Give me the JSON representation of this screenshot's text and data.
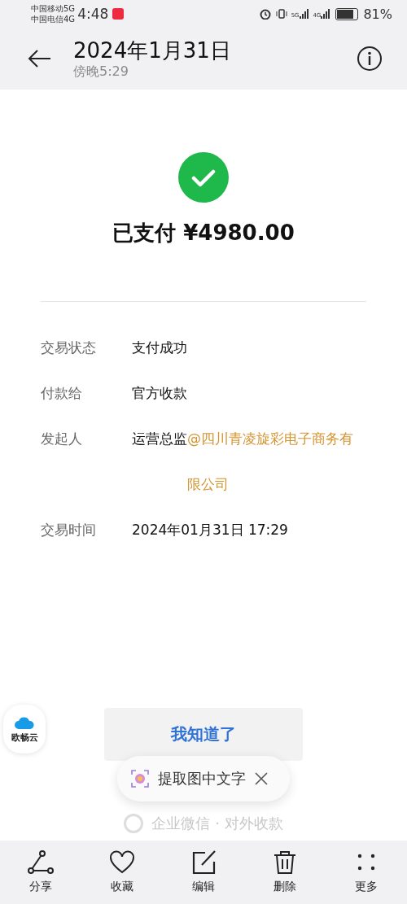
{
  "status_bar": {
    "carrier_1": "中国移动5G",
    "carrier_2": "中国电信4G",
    "time": "4:48",
    "signal_1": "5G",
    "signal_2": "4G",
    "battery": "81%",
    "battery_meter": {
      "level": 0.81
    }
  },
  "header": {
    "title": "2024年1月31日",
    "subtitle": "傍晚5:29"
  },
  "payment": {
    "status": "已支付 ¥4980.00",
    "success": true
  },
  "details": [
    {
      "label": "交易状态",
      "value": "支付成功"
    },
    {
      "label": "付款给",
      "value": "官方收款"
    },
    {
      "label": "发起人",
      "value": "运营总监",
      "link": "@四川青凌旋彩电子商务有限公司"
    },
    {
      "label": "交易时间",
      "value": "2024年01月31日 17:29"
    }
  ],
  "floating_badge": {
    "label": "欧畅云"
  },
  "confirm_button": "我知道了",
  "toast": {
    "label": "提取图中文字"
  },
  "footer_text": "企业微信 · 对外收款",
  "toolbar": [
    {
      "kind": "share",
      "label": "分享"
    },
    {
      "kind": "favorite",
      "label": "收藏"
    },
    {
      "kind": "edit",
      "label": "编辑"
    },
    {
      "kind": "delete",
      "label": "删除"
    },
    {
      "kind": "more",
      "label": "更多"
    }
  ]
}
